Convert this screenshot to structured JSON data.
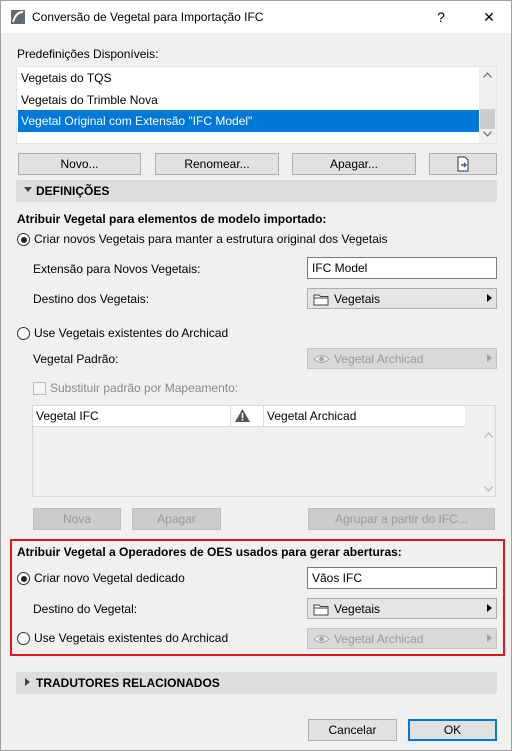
{
  "window": {
    "title": "Conversão de Vegetal para Importação IFC",
    "help": "?",
    "close": "✕"
  },
  "presets": {
    "label": "Predefinições Disponíveis:",
    "items": [
      "Vegetais do TQS",
      "Vegetais do Trimble Nova",
      "Vegetal Original com Extensão \"IFC Model\""
    ],
    "selected_index": 2,
    "buttons": {
      "new": "Novo...",
      "rename": "Renomear...",
      "delete": "Apagar..."
    }
  },
  "definitions": {
    "header": "DEFINIÇÕES",
    "assign_title": "Atribuir Vegetal para elementos de modelo importado:",
    "opt_create": "Criar novos Vegetais para manter a estrutura original dos Vegetais",
    "ext_label": "Extensão para Novos Vegetais:",
    "ext_value": "IFC Model",
    "dest_label": "Destino dos Vegetais:",
    "dest_value": "Vegetais",
    "opt_existing": "Use Vegetais existentes do Archicad",
    "default_label": "Vegetal Padrão:",
    "default_value": "Vegetal Archicad",
    "replace_label": "Substituir padrão por Mapeamento:",
    "table": {
      "col_ifc": "Vegetal IFC",
      "col_archicad": "Vegetal Archicad"
    },
    "btn_new": "Nova",
    "btn_delete": "Apagar",
    "btn_group": "Agrupar a partir do IFC..."
  },
  "openings": {
    "title": "Atribuir Vegetal a Operadores de OES usados para gerar aberturas:",
    "opt_create": "Criar novo Vegetal dedicado",
    "create_value": "Vãos IFC",
    "dest_label": "Destino do Vegetal:",
    "dest_value": "Vegetais",
    "opt_existing": "Use Vegetais existentes do Archicad",
    "existing_value": "Vegetal Archicad"
  },
  "translators": {
    "header": "TRADUTORES RELACIONADOS"
  },
  "footer": {
    "cancel": "Cancelar",
    "ok": "OK"
  },
  "colors": {
    "selection": "#0078d7",
    "highlight_border": "#e0161d"
  }
}
